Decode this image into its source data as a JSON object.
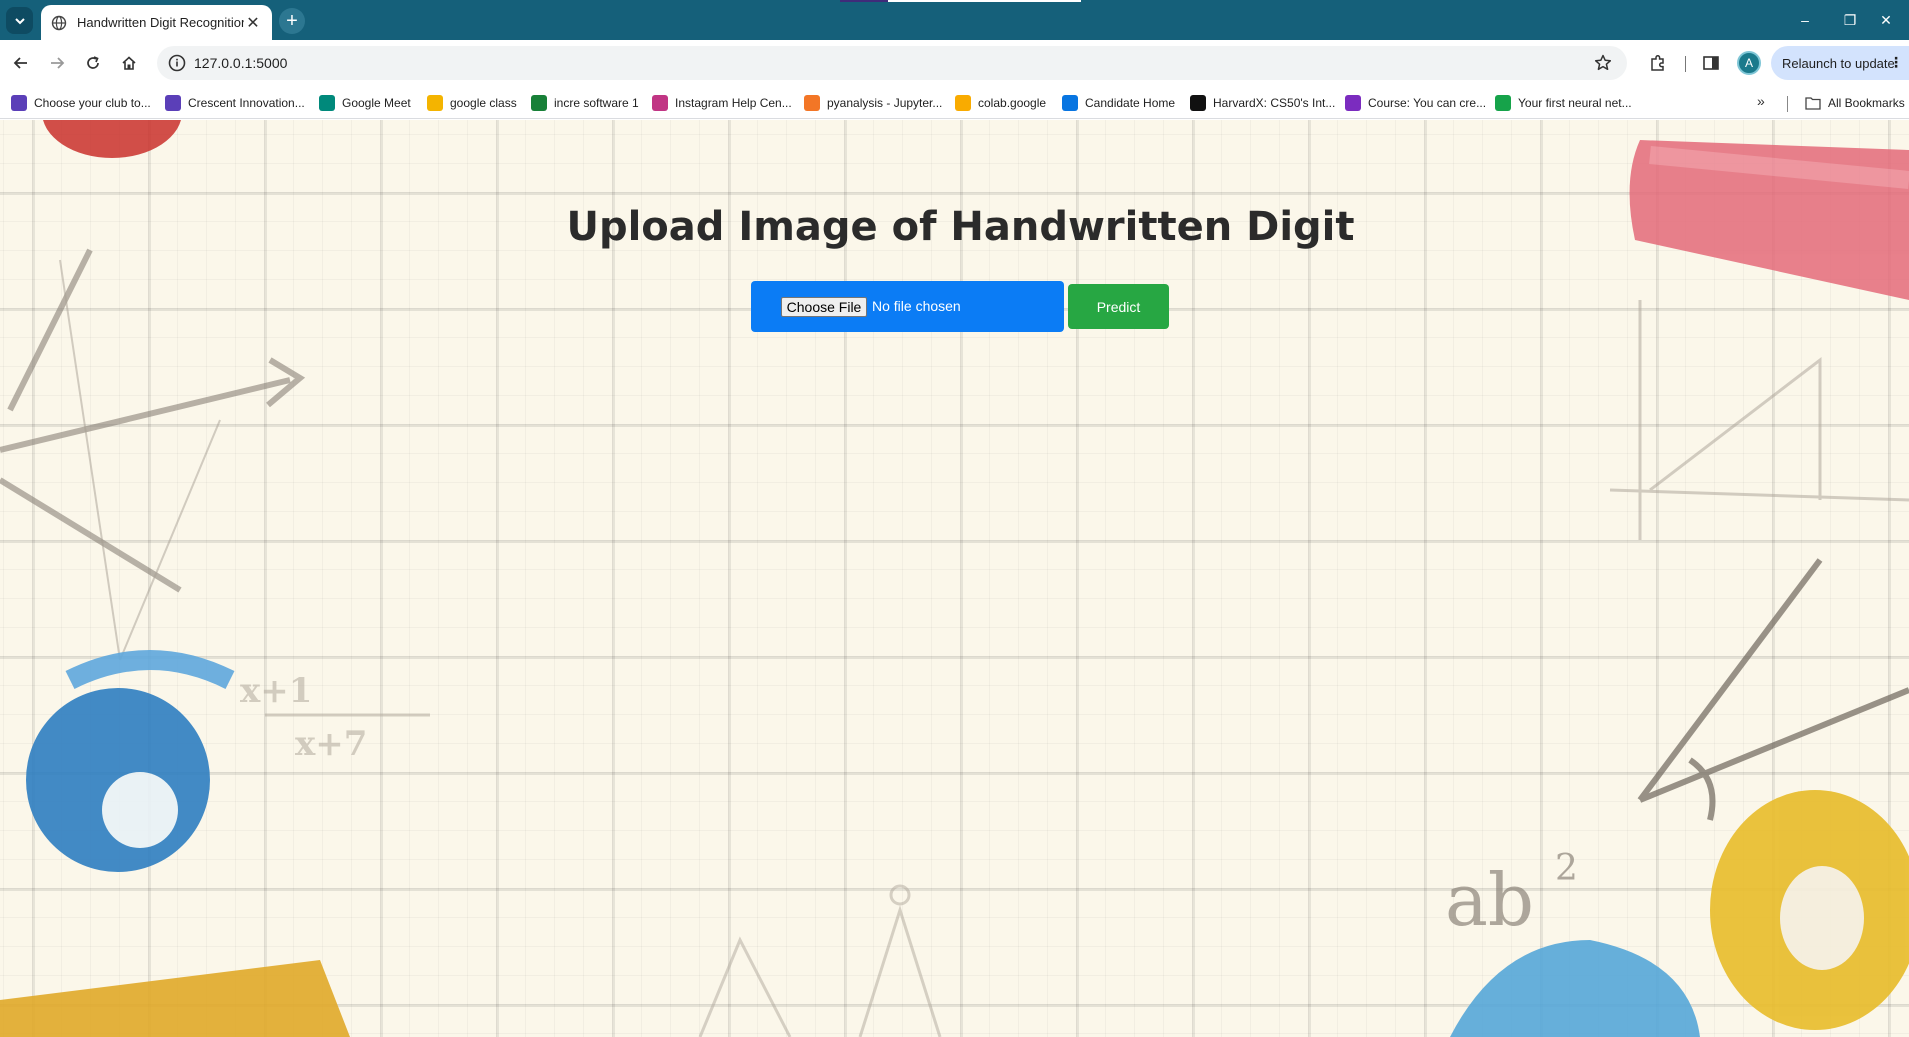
{
  "browser": {
    "tab": {
      "title": "Handwritten Digit Recognition",
      "close_glyph": "✕"
    },
    "new_tab_glyph": "+",
    "address": {
      "url": "127.0.0.1:5000"
    },
    "profile_initial": "A",
    "relaunch_label": "Relaunch to update",
    "window_controls": {
      "minimize": "–",
      "restore": "❐",
      "close": "✕"
    },
    "colors": {
      "frame": "#15607a",
      "relaunch_bg": "#d3e3fd"
    }
  },
  "bookmarks": {
    "items": [
      {
        "label": "Choose your club to...",
        "icon": "form-icon",
        "color": "#5b3fb8"
      },
      {
        "label": "Crescent Innovation...",
        "icon": "form-icon",
        "color": "#5b3fb8"
      },
      {
        "label": "Google Meet",
        "icon": "meet-icon",
        "color": "#00897b"
      },
      {
        "label": "google class",
        "icon": "classroom-icon",
        "color": "#f4b400"
      },
      {
        "label": "incre software 1",
        "icon": "check-circle-icon",
        "color": "#188038"
      },
      {
        "label": "Instagram Help Cen...",
        "icon": "instagram-icon",
        "color": "#c13584"
      },
      {
        "label": "pyanalysis - Jupyter...",
        "icon": "jupyter-icon",
        "color": "#f37626"
      },
      {
        "label": "colab.google",
        "icon": "colab-icon",
        "color": "#f9ab00"
      },
      {
        "label": "Candidate Home",
        "icon": "workday-icon",
        "color": "#0875e1"
      },
      {
        "label": "HarvardX: CS50's Int...",
        "icon": "edx-icon",
        "color": "#111111"
      },
      {
        "label": "Course: You can cre...",
        "icon": "course-icon",
        "color": "#7b2cbf"
      },
      {
        "label": "Your first neural net...",
        "icon": "kaggle-icon",
        "color": "#16a34a"
      }
    ],
    "more_glyph": "»",
    "all_bookmarks_label": "All Bookmarks"
  },
  "page": {
    "title": "Upload Image of Handwritten Digit",
    "form": {
      "choose_file_label": "Choose File",
      "file_status": "No file chosen",
      "predict_label": "Predict"
    },
    "colors": {
      "file_box": "#0b7cf5",
      "predict": "#27a743",
      "background": "#fbf7ea"
    }
  }
}
